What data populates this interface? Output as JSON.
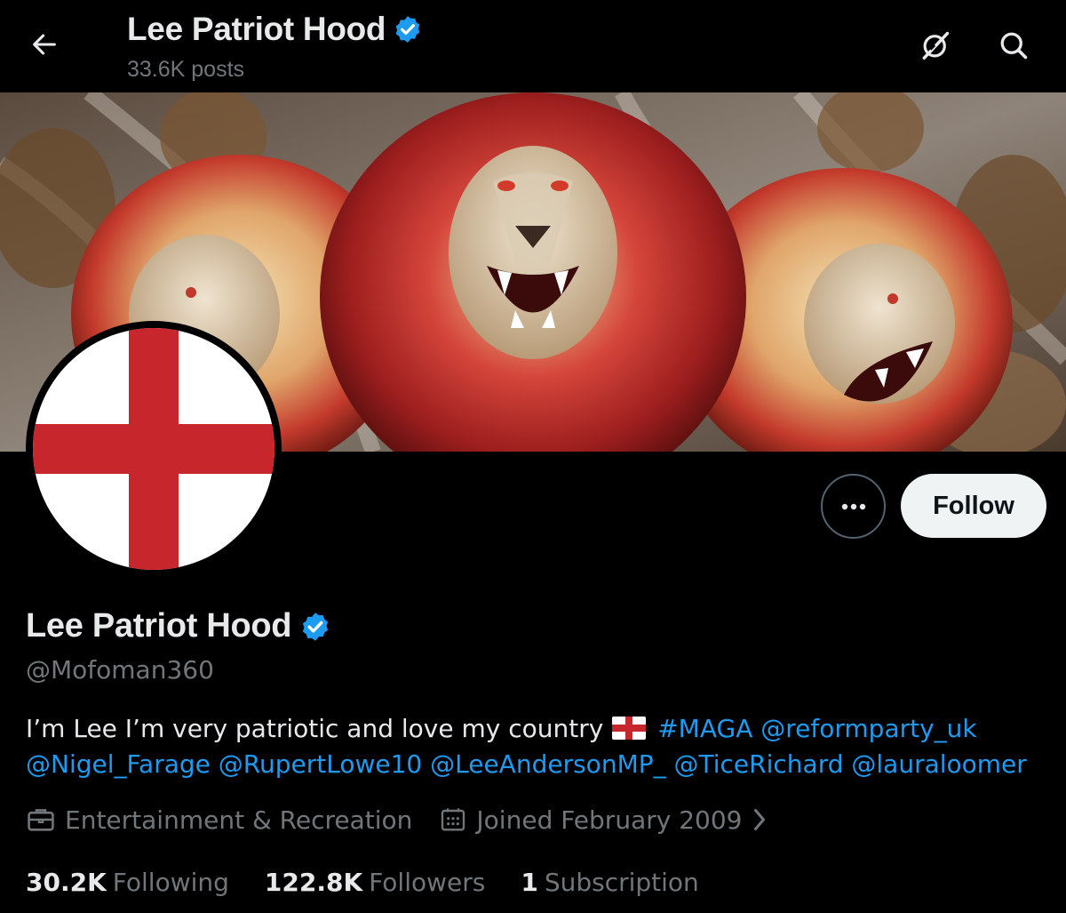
{
  "header": {
    "title": "Lee Patriot Hood",
    "posts_count": "33.6K posts",
    "back_icon": "arrow-left-icon",
    "grok_icon": "grok-icon",
    "search_icon": "search-icon"
  },
  "profile": {
    "display_name": "Lee Patriot Hood",
    "handle": "@Mofoman360",
    "verified": true,
    "verified_color": "#1d9bf0",
    "avatar": "england-flag",
    "banner": "three-roaring-lions-red-gold"
  },
  "actions": {
    "more_icon": "more-horizontal-icon",
    "follow_label": "Follow"
  },
  "bio": {
    "text": "I’m Lee I’m very patriotic and love my country",
    "emoji": "england-flag-emoji",
    "hashtag": "#MAGA",
    "mentions": [
      "@reformparty_uk",
      "@Nigel_Farage",
      "@RupertLowe10",
      "@LeeAndersonMP_",
      "@TiceRichard",
      "@lauraloomer"
    ]
  },
  "meta": {
    "category": "Entertainment & Recreation",
    "joined": "Joined February 2009"
  },
  "stats": {
    "following_count": "30.2K",
    "following_label": "Following",
    "followers_count": "122.8K",
    "followers_label": "Followers",
    "subscriptions_count": "1",
    "subscriptions_label": "Subscription"
  },
  "colors": {
    "background": "#000000",
    "text_primary": "#e7e9ea",
    "text_secondary": "#71767b",
    "accent": "#1d9bf0",
    "flag_red": "#c8262d"
  }
}
